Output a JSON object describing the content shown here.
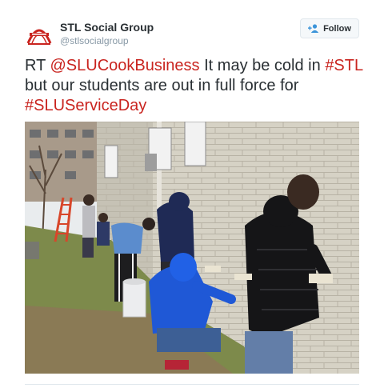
{
  "account": {
    "name": "STL Social Group",
    "handle": "@stlsocialgroup",
    "avatar_icon": "stl-social-group-logo-icon",
    "brand_color": "#c9241f"
  },
  "follow": {
    "label": "Follow",
    "icon": "add-user-icon"
  },
  "tweet": {
    "prefix": "RT ",
    "mention": "@SLUCookBusiness",
    "part1": " It may be cold in ",
    "hashtag1": "#STL",
    "part2": " but our students are out in full force for ",
    "hashtag2": "#SLUServiceDay",
    "link_color": "#c9241f"
  },
  "photo": {
    "subject": "students-painting-brick-wall-photo"
  }
}
